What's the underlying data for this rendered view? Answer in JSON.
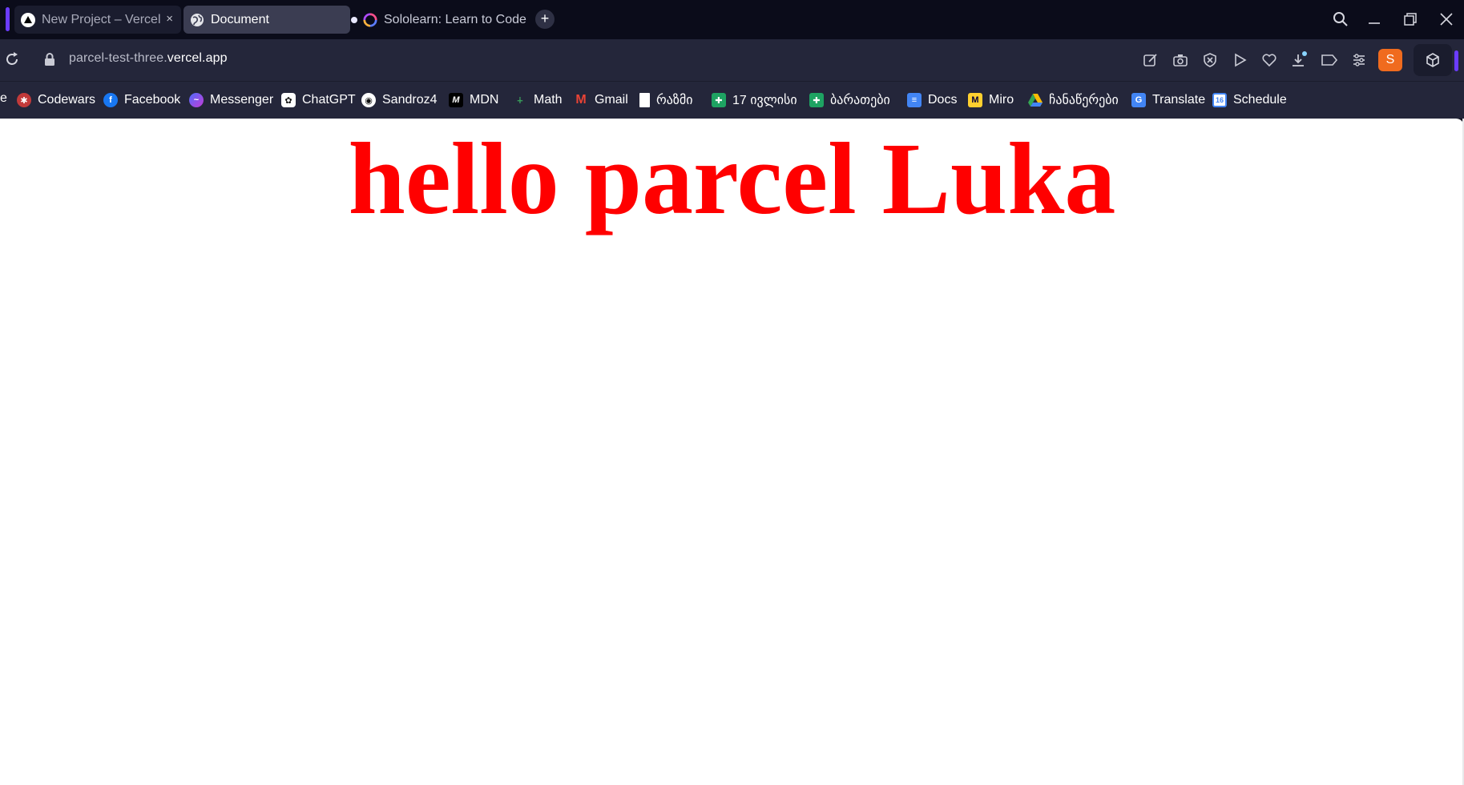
{
  "tabs": [
    {
      "label": "New Project – Vercel",
      "icon": "vercel-triangle-icon",
      "close": "×"
    },
    {
      "label": "Document",
      "icon": "globe-icon"
    },
    {
      "label": "Sololearn: Learn to Code",
      "icon": "sololearn-icon"
    }
  ],
  "window_controls": {
    "search": "search-icon",
    "minimize": "minimize-icon",
    "restore": "restore-icon",
    "close": "close-icon"
  },
  "address_bar": {
    "url_prefix": "parcel-test-three.",
    "url_host": "vercel.app"
  },
  "toolbar": {
    "profile_initial": "S",
    "accent_color": "#6b3cff",
    "profile_color": "#f06b1e"
  },
  "bookmarks": {
    "cut_item": "e",
    "items": [
      {
        "label": "Codewars",
        "icon": "codewars-icon",
        "color": "#c23a3a"
      },
      {
        "label": "Facebook",
        "icon": "facebook-icon",
        "color": "#1877f2"
      },
      {
        "label": "Messenger",
        "icon": "messenger-icon",
        "color": "#a334fa"
      },
      {
        "label": "ChatGPT",
        "icon": "chatgpt-icon",
        "color": "#ffffff"
      },
      {
        "label": "Sandroz4",
        "icon": "github-icon",
        "color": "#ffffff"
      },
      {
        "label": "MDN",
        "icon": "mdn-icon",
        "color": "#000000"
      },
      {
        "label": "Math",
        "icon": "math-icon",
        "color": "#3aa55d"
      },
      {
        "label": "Gmail",
        "icon": "gmail-icon",
        "color": "#ea4335"
      },
      {
        "label": "რაზმი",
        "icon": "document-icon",
        "color": "#ffffff"
      },
      {
        "label": "17 ივლისი",
        "icon": "sheets-icon",
        "color": "#1ea362"
      },
      {
        "label": "ბარათები",
        "icon": "sheets-icon",
        "color": "#1ea362"
      },
      {
        "label": "Docs",
        "icon": "docs-icon",
        "color": "#4285f4"
      },
      {
        "label": "Miro",
        "icon": "miro-icon",
        "color": "#ffd02f"
      },
      {
        "label": "ჩანაწერები",
        "icon": "drive-icon",
        "color": "#34a853"
      },
      {
        "label": "Translate",
        "icon": "translate-icon",
        "color": "#4285f4"
      },
      {
        "label": "Schedule",
        "icon": "calendar-icon",
        "color": "#4285f4"
      }
    ]
  },
  "page": {
    "heading": "hello parcel Luka",
    "heading_color": "#ff0000"
  }
}
